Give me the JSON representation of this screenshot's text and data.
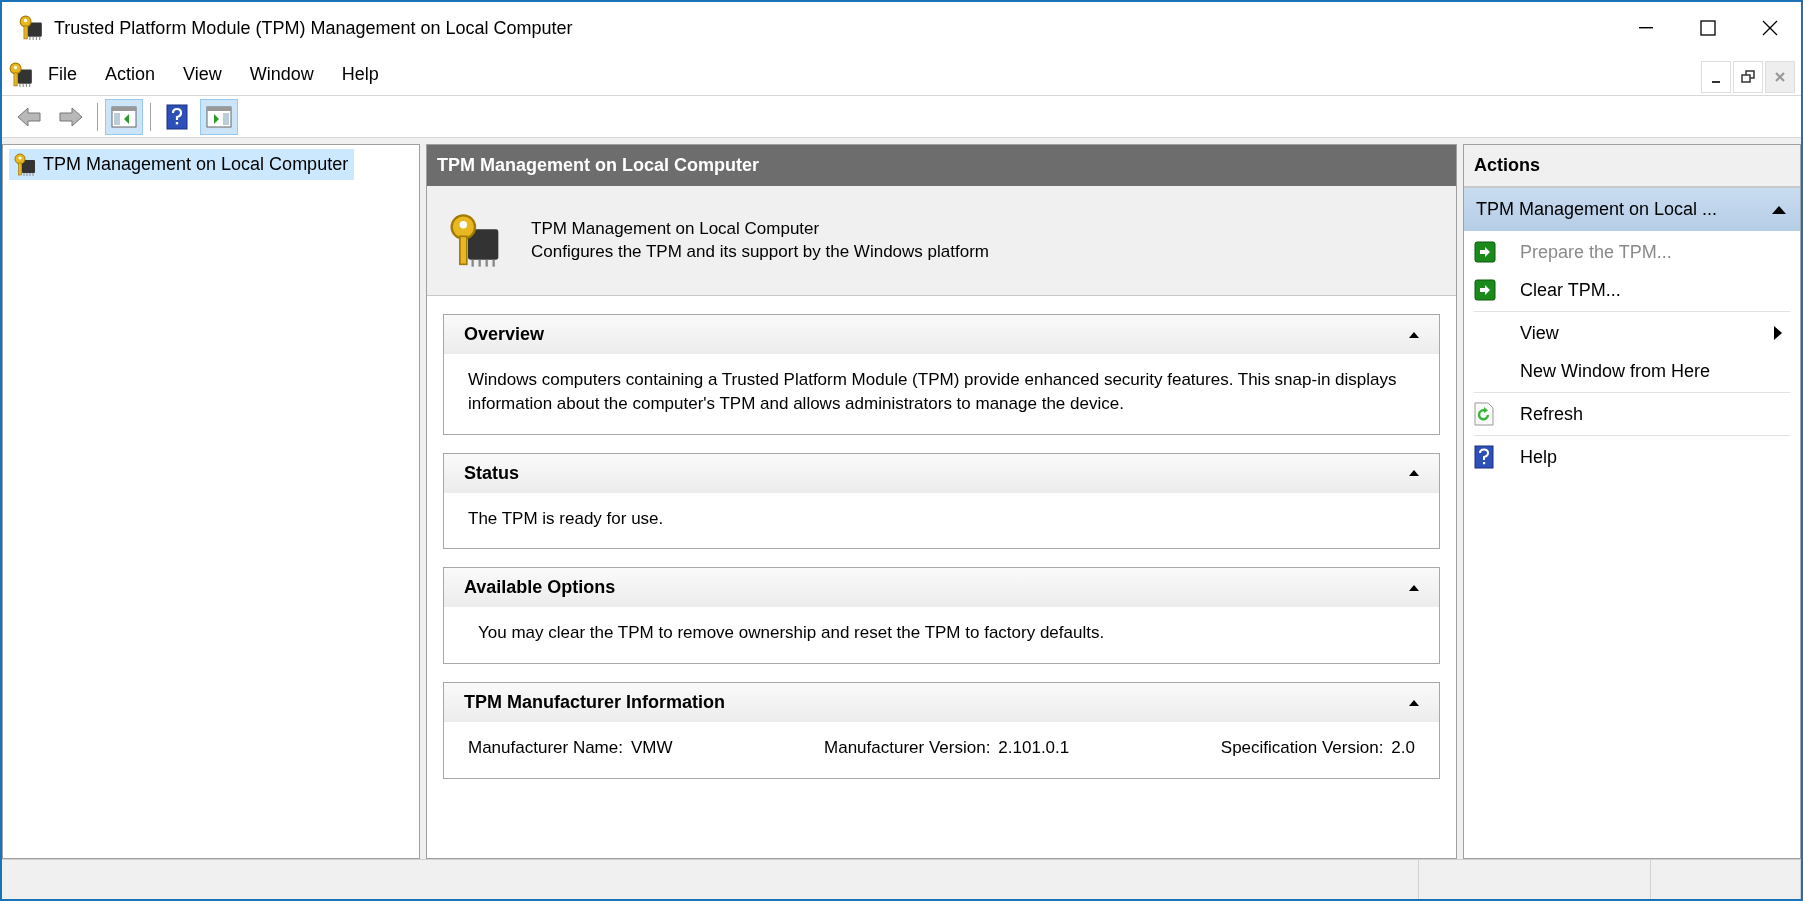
{
  "window": {
    "title": "Trusted Platform Module (TPM) Management on Local Computer"
  },
  "menu": [
    "File",
    "Action",
    "View",
    "Window",
    "Help"
  ],
  "toolbar": [
    {
      "kind": "back",
      "disabled": true,
      "pressed": false
    },
    {
      "kind": "forward",
      "disabled": true,
      "pressed": false
    },
    {
      "kind": "tree",
      "disabled": false,
      "pressed": true
    },
    {
      "kind": "help",
      "disabled": false,
      "pressed": false
    },
    {
      "kind": "actionpane",
      "disabled": false,
      "pressed": true
    }
  ],
  "tree": [
    {
      "label": "TPM Management on Local Computer",
      "selected": true
    }
  ],
  "center": {
    "title": "TPM Management on Local Computer",
    "header": {
      "title": "TPM Management on Local Computer",
      "description": "Configures the TPM and its support by the Windows platform"
    },
    "sections": [
      {
        "title": "Overview",
        "expanded": true,
        "kind": "text",
        "text": "Windows computers containing a Trusted Platform Module (TPM) provide enhanced security features. This snap-in displays information about the computer's TPM and allows administrators to manage the device."
      },
      {
        "title": "Status",
        "expanded": true,
        "kind": "text",
        "text": "The TPM is ready for use."
      },
      {
        "title": "Available Options",
        "expanded": true,
        "kind": "option",
        "text": "You may clear the TPM to remove ownership and reset the TPM to factory defaults."
      },
      {
        "title": "TPM Manufacturer Information",
        "expanded": true,
        "kind": "fields",
        "fields": [
          {
            "label": "Manufacturer Name:",
            "value": "VMW"
          },
          {
            "label": "Manufacturer Version:",
            "value": "2.101.0.1"
          },
          {
            "label": "Specification Version:",
            "value": "2.0"
          }
        ]
      }
    ]
  },
  "actions": {
    "title": "Actions",
    "group": {
      "label": "TPM Management on Local ...",
      "expanded": true
    },
    "groups": [
      [
        {
          "label": "Prepare the TPM...",
          "kind": "arrow",
          "disabled": true
        },
        {
          "label": "Clear TPM...",
          "kind": "arrow",
          "disabled": false
        }
      ],
      [
        {
          "label": "View",
          "kind": "submenu",
          "disabled": false
        },
        {
          "label": "New Window from Here",
          "kind": "plain",
          "disabled": false
        }
      ],
      [
        {
          "label": "Refresh",
          "kind": "refresh",
          "disabled": false
        }
      ],
      [
        {
          "label": "Help",
          "kind": "help",
          "disabled": false
        }
      ]
    ]
  }
}
